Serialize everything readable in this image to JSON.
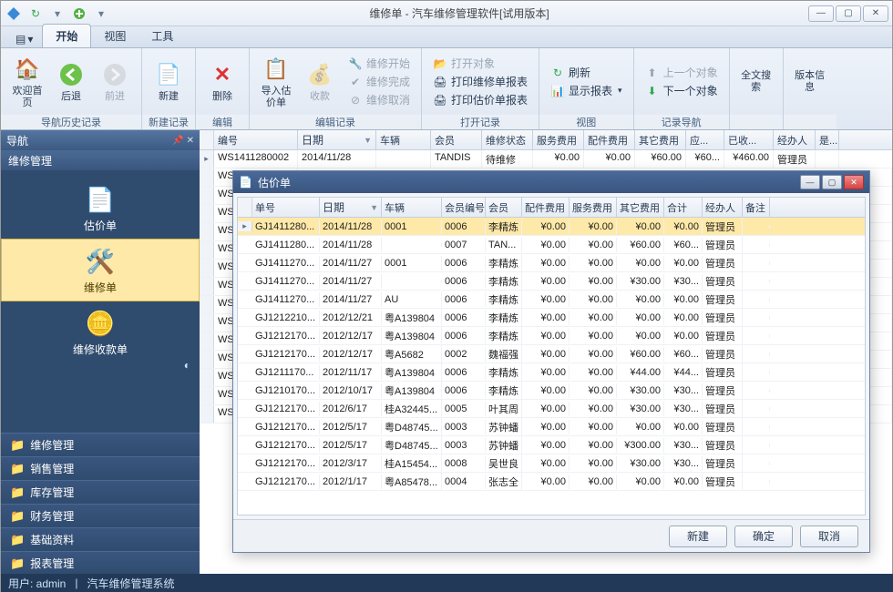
{
  "window": {
    "title": "维修单 - 汽车维修管理软件[试用版本]"
  },
  "ribbon": {
    "menus": {
      "dropdown": "▾",
      "tab_start": "开始",
      "tab_view": "视图",
      "tab_tools": "工具"
    },
    "nav_history": {
      "label": "导航历史记录",
      "home": "欢迎首页",
      "back": "后退",
      "forward": "前进"
    },
    "new_record": {
      "label": "新建记录",
      "new": "新建"
    },
    "edit": {
      "label": "编辑",
      "delete": "删除"
    },
    "edit_record": {
      "label": "编辑记录",
      "import": "导入估价单",
      "collect": "收款",
      "start": "维修开始",
      "done": "维修完成",
      "cancel": "维修取消"
    },
    "open_record": {
      "label": "打开记录",
      "open_obj": "打开对象",
      "print_repair": "打印维修单报表",
      "print_est": "打印估价单报表"
    },
    "view": {
      "label": "视图",
      "refresh": "刷新",
      "show_report": "显示报表"
    },
    "record_nav": {
      "label": "记录导航",
      "prev": "上一个对象",
      "next": "下一个对象"
    },
    "search": "全文搜索",
    "version": "版本信息"
  },
  "sidebar": {
    "title": "导航",
    "section": "维修管理",
    "items": [
      {
        "label": "估价单"
      },
      {
        "label": "维修单"
      },
      {
        "label": "维修收款单"
      }
    ],
    "folders": [
      "维修管理",
      "销售管理",
      "库存管理",
      "财务管理",
      "基础资料",
      "报表管理"
    ]
  },
  "main_grid": {
    "columns": [
      "编号",
      "日期",
      "车辆",
      "会员",
      "维修状态",
      "服务费用",
      "配件费用",
      "其它费用",
      "应...",
      "已收...",
      "经办人",
      "是..."
    ],
    "rows": [
      {
        "id": "WS1411280002",
        "date": "2014/11/28",
        "veh": "",
        "mem": "TANDIS",
        "stat": "待维修",
        "svc": "¥0.00",
        "part": "¥0.00",
        "oth": "¥60.00",
        "due": "¥60...",
        "paid": "¥460.00",
        "op": "管理员"
      }
    ],
    "stub_ids": [
      "WS",
      "WS",
      "WS",
      "WS",
      "WS",
      "WS",
      "WS",
      "WS",
      "WS",
      "WS",
      "WS",
      "WS",
      "WS",
      "WS"
    ]
  },
  "dialog": {
    "title": "估价单",
    "columns": [
      "单号",
      "日期",
      "车辆",
      "会员编号",
      "会员",
      "配件费用",
      "服务费用",
      "其它费用",
      "合计",
      "经办人",
      "备注"
    ],
    "rows": [
      {
        "no": "GJ1411280...",
        "date": "2014/11/28",
        "veh": "0001",
        "mno": "0006",
        "mem": "李精炼",
        "part": "¥0.00",
        "svc": "¥0.00",
        "oth": "¥0.00",
        "tot": "¥0.00",
        "op": "管理员"
      },
      {
        "no": "GJ1411280...",
        "date": "2014/11/28",
        "veh": "",
        "mno": "0007",
        "mem": "TAN...",
        "part": "¥0.00",
        "svc": "¥0.00",
        "oth": "¥60.00",
        "tot": "¥60...",
        "op": "管理员"
      },
      {
        "no": "GJ1411270...",
        "date": "2014/11/27",
        "veh": "0001",
        "mno": "0006",
        "mem": "李精炼",
        "part": "¥0.00",
        "svc": "¥0.00",
        "oth": "¥0.00",
        "tot": "¥0.00",
        "op": "管理员"
      },
      {
        "no": "GJ1411270...",
        "date": "2014/11/27",
        "veh": "",
        "mno": "0006",
        "mem": "李精炼",
        "part": "¥0.00",
        "svc": "¥0.00",
        "oth": "¥30.00",
        "tot": "¥30...",
        "op": "管理员"
      },
      {
        "no": "GJ1411270...",
        "date": "2014/11/27",
        "veh": "AU",
        "mno": "0006",
        "mem": "李精炼",
        "part": "¥0.00",
        "svc": "¥0.00",
        "oth": "¥0.00",
        "tot": "¥0.00",
        "op": "管理员"
      },
      {
        "no": "GJ1212210...",
        "date": "2012/12/21",
        "veh": "粤A139804",
        "mno": "0006",
        "mem": "李精炼",
        "part": "¥0.00",
        "svc": "¥0.00",
        "oth": "¥0.00",
        "tot": "¥0.00",
        "op": "管理员"
      },
      {
        "no": "GJ1212170...",
        "date": "2012/12/17",
        "veh": "粤A139804",
        "mno": "0006",
        "mem": "李精炼",
        "part": "¥0.00",
        "svc": "¥0.00",
        "oth": "¥0.00",
        "tot": "¥0.00",
        "op": "管理员"
      },
      {
        "no": "GJ1212170...",
        "date": "2012/12/17",
        "veh": "粤A5682",
        "mno": "0002",
        "mem": "魏福强",
        "part": "¥0.00",
        "svc": "¥0.00",
        "oth": "¥60.00",
        "tot": "¥60...",
        "op": "管理员"
      },
      {
        "no": "GJ1211170...",
        "date": "2012/11/17",
        "veh": "粤A139804",
        "mno": "0006",
        "mem": "李精炼",
        "part": "¥0.00",
        "svc": "¥0.00",
        "oth": "¥44.00",
        "tot": "¥44...",
        "op": "管理员"
      },
      {
        "no": "GJ1210170...",
        "date": "2012/10/17",
        "veh": "粤A139804",
        "mno": "0006",
        "mem": "李精炼",
        "part": "¥0.00",
        "svc": "¥0.00",
        "oth": "¥30.00",
        "tot": "¥30...",
        "op": "管理员"
      },
      {
        "no": "GJ1212170...",
        "date": "2012/6/17",
        "veh": "桂A32445...",
        "mno": "0005",
        "mem": "叶其周",
        "part": "¥0.00",
        "svc": "¥0.00",
        "oth": "¥30.00",
        "tot": "¥30...",
        "op": "管理员"
      },
      {
        "no": "GJ1212170...",
        "date": "2012/5/17",
        "veh": "粤D48745...",
        "mno": "0003",
        "mem": "苏钟蟠",
        "part": "¥0.00",
        "svc": "¥0.00",
        "oth": "¥0.00",
        "tot": "¥0.00",
        "op": "管理员"
      },
      {
        "no": "GJ1212170...",
        "date": "2012/5/17",
        "veh": "粤D48745...",
        "mno": "0003",
        "mem": "苏钟蟠",
        "part": "¥0.00",
        "svc": "¥0.00",
        "oth": "¥300.00",
        "tot": "¥30...",
        "op": "管理员"
      },
      {
        "no": "GJ1212170...",
        "date": "2012/3/17",
        "veh": "桂A15454...",
        "mno": "0008",
        "mem": "吴世良",
        "part": "¥0.00",
        "svc": "¥0.00",
        "oth": "¥30.00",
        "tot": "¥30...",
        "op": "管理员"
      },
      {
        "no": "GJ1212170...",
        "date": "2012/1/17",
        "veh": "粤A85478...",
        "mno": "0004",
        "mem": "张志全",
        "part": "¥0.00",
        "svc": "¥0.00",
        "oth": "¥0.00",
        "tot": "¥0.00",
        "op": "管理员"
      }
    ],
    "buttons": {
      "new": "新建",
      "ok": "确定",
      "cancel": "取消"
    }
  },
  "status": {
    "user_label": "用户: ",
    "user": "admin",
    "app": "汽车维修管理系统"
  }
}
